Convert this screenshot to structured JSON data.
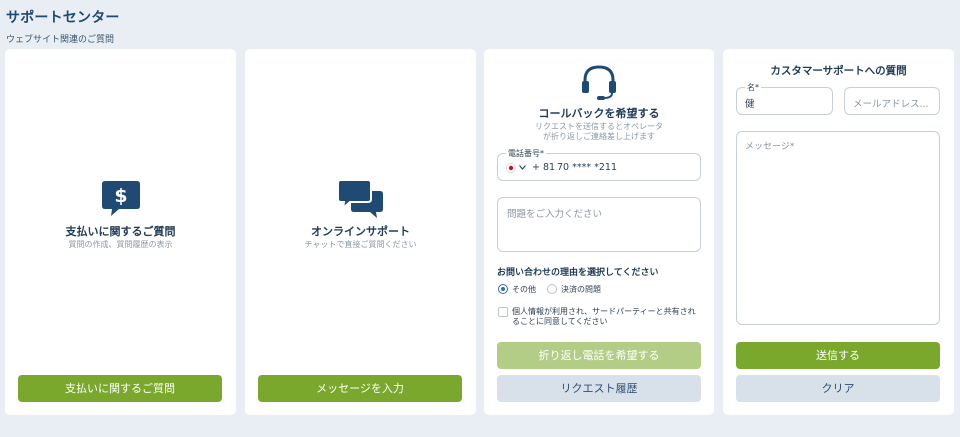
{
  "header": {
    "title": "サポートセンター",
    "subtitle": "ウェブサイト関連のご質問"
  },
  "payment_card": {
    "icon": "dollar-chat-icon",
    "title": "支払いに関するご質問",
    "subtitle": "質問の作成、質問履歴の表示",
    "button": "支払いに関するご質問"
  },
  "online_card": {
    "icon": "chat-bubbles-icon",
    "title": "オンラインサポート",
    "subtitle": "チャットで直接ご質問ください",
    "button": "メッセージを入力"
  },
  "callback_card": {
    "icon": "headset-icon",
    "title": "コールバックを希望する",
    "description_line1": "リクエストを送信するとオペレータ",
    "description_line2": "が折り返しご連絡差し上げます",
    "phone_label": "電話番号*",
    "phone_code": "+ 81",
    "phone_value": "70 **** *211",
    "problem_placeholder": "問題をご入力ください",
    "reason_title": "お問い合わせの理由を選択してください",
    "reason_options": [
      "その他",
      "決済の問題"
    ],
    "consent_line1": "個人情報が利用され、サードパーティーと共有され",
    "consent_line2": "ることに同意してください",
    "submit_button": "折り返し電話を希望する",
    "history_button": "リクエスト履歴"
  },
  "customer_card": {
    "title": "カスタマーサポートへの質問",
    "name_label": "名*",
    "name_value": "健",
    "email_placeholder": "メールアドレス...",
    "message_placeholder": "メッセージ*",
    "send_button": "送信する",
    "clear_button": "クリア"
  },
  "colors": {
    "accent_green": "#7aa82c",
    "primary_blue": "#1f4a74",
    "background": "#e8eef3"
  }
}
